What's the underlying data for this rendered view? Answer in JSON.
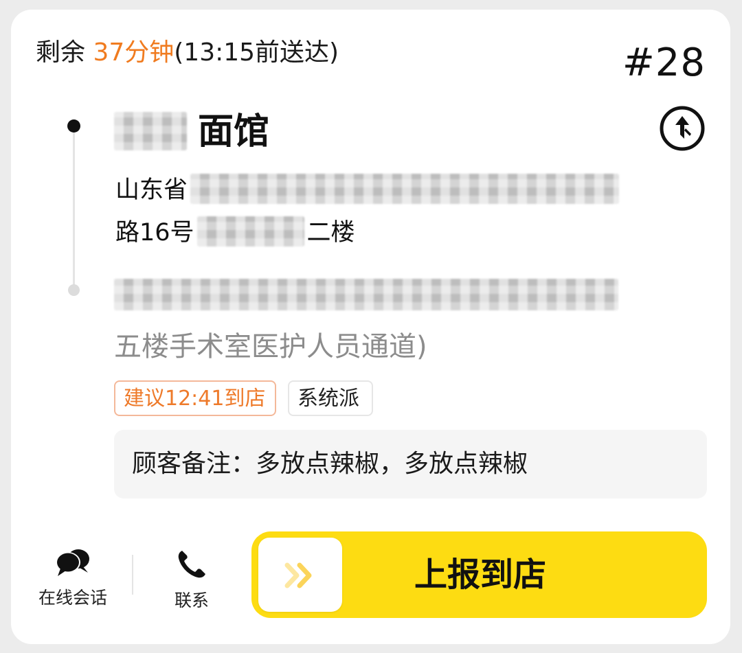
{
  "header": {
    "remaining_prefix": "剩余 ",
    "remaining_minutes": "37分钟",
    "deliver_before": "(13:15前送达)",
    "order_number": "#28"
  },
  "pickup": {
    "shop_name": "面馆",
    "address_line1": "山东省",
    "address_line2_prefix": "路16号",
    "address_line2_suffix": "二楼"
  },
  "destination": {
    "detail_text": "五楼手术室医护人员通道)"
  },
  "tags": {
    "suggest_arrival": "建议12:41到店",
    "dispatch_type": "系统派"
  },
  "note": {
    "text": "顾客备注：多放点辣椒，多放点辣椒"
  },
  "actions": {
    "chat_label": "在线会话",
    "call_label": "联系"
  },
  "report_button": {
    "label": "上报到店"
  },
  "colors": {
    "accent_orange": "#f07b1f",
    "button_yellow": "#fddc12",
    "tag_border_orange": "#f4b899"
  },
  "icons": [
    "navigate-icon",
    "chat-bubbles-icon",
    "phone-icon",
    "double-chevron-right-icon"
  ]
}
